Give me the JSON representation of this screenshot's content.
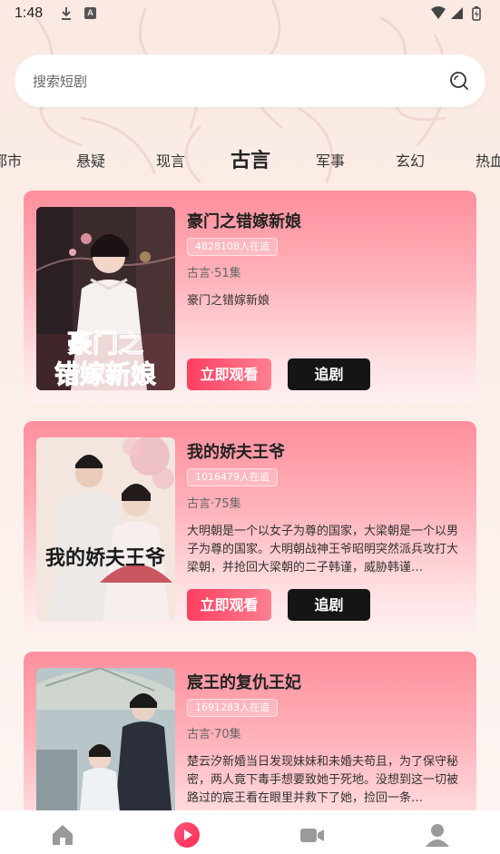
{
  "status_bar": {
    "time": "1:48",
    "a_badge": "A"
  },
  "search": {
    "placeholder": "搜索短剧"
  },
  "tabs": [
    {
      "label": "都市"
    },
    {
      "label": "悬疑"
    },
    {
      "label": "现言"
    },
    {
      "label": "古言",
      "active": true
    },
    {
      "label": "军事"
    },
    {
      "label": "玄幻"
    },
    {
      "label": "热血"
    }
  ],
  "dramas": [
    {
      "title": "豪门之错嫁新娘",
      "followers": "4828108人在追",
      "meta": "古言·51集",
      "description": "豪门之错嫁新娘",
      "poster_text": "豪门之错嫁新娘",
      "watch_label": "立即观看",
      "follow_label": "追剧"
    },
    {
      "title": "我的娇夫王爷",
      "followers": "1016479人在追",
      "meta": "古言·75集",
      "description": "大明朝是一个以女子为尊的国家，大梁朝是一个以男子为尊的国家。大明朝战神王爷昭明突然派兵攻打大梁朝，并抢回大梁朝的二子韩谨，威胁韩谨…",
      "poster_text": "我的娇夫王爷",
      "watch_label": "立即观看",
      "follow_label": "追剧"
    },
    {
      "title": "宸王的复仇王妃",
      "followers": "1691283人在追",
      "meta": "古言·70集",
      "description": "楚云汐新婚当日发现妹妹和未婚夫苟且，为了保守秘密，两人竟下毒手想要致她于死地。没想到这一切被路过的宸王看在眼里并救下了她，捡回一条…",
      "poster_text": "",
      "watch_label": "立即观看",
      "follow_label": "追剧"
    }
  ],
  "bottom_nav": [
    {
      "icon": "home-icon"
    },
    {
      "icon": "play-icon",
      "active": true
    },
    {
      "icon": "video-camera-icon"
    },
    {
      "icon": "profile-icon"
    }
  ],
  "colors": {
    "accent": "#ff3f62",
    "card_top": "#ff8f9c",
    "follow_button": "#151515",
    "background": "#fbe9e3"
  }
}
